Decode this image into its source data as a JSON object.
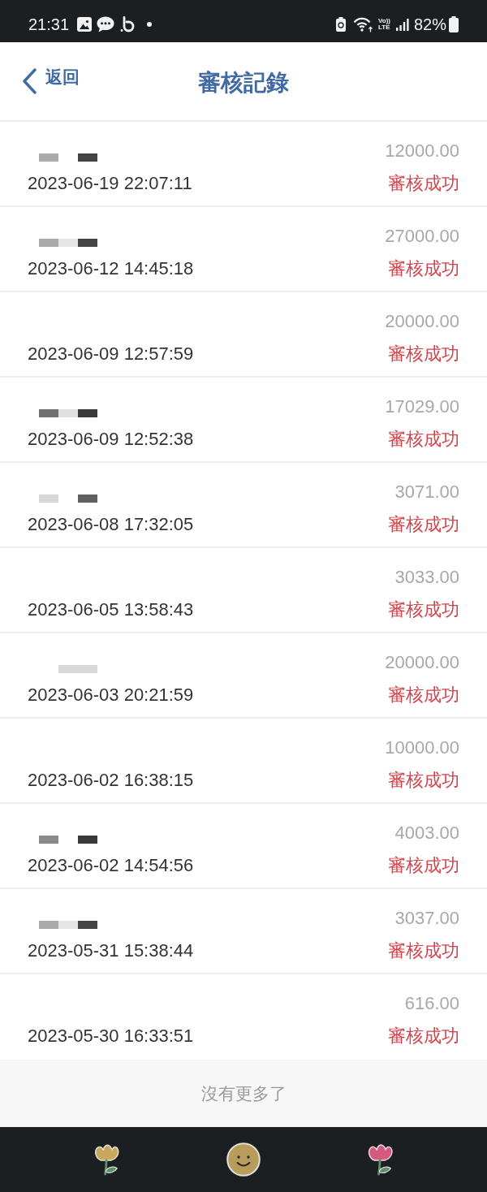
{
  "status_bar": {
    "time": "21:31",
    "volte": {
      "top": "Vo))",
      "bottom": "LTE"
    },
    "battery_text": "82%"
  },
  "header": {
    "back_label": "返回",
    "title": "審核記錄"
  },
  "records": [
    {
      "redaction": [
        {
          "kind": "block",
          "color": "#aaaaaa"
        },
        {
          "kind": "gap"
        },
        {
          "kind": "block",
          "color": "#444444"
        }
      ],
      "time": "2023-06-19 22:07:11",
      "amount": "12000.00",
      "status": "審核成功"
    },
    {
      "redaction": [
        {
          "kind": "block",
          "color": "#aaaaaa"
        },
        {
          "kind": "block",
          "color": "#e6e6e6"
        },
        {
          "kind": "block",
          "color": "#444444"
        }
      ],
      "time": "2023-06-12 14:45:18",
      "amount": "27000.00",
      "status": "審核成功"
    },
    {
      "time": "2023-06-09 12:57:59",
      "amount": "20000.00",
      "status": "審核成功"
    },
    {
      "redaction": [
        {
          "kind": "block",
          "color": "#707070"
        },
        {
          "kind": "block",
          "color": "#e0e0e0"
        },
        {
          "kind": "block",
          "color": "#3a3a3a"
        }
      ],
      "time": "2023-06-09 12:52:38",
      "amount": "17029.00",
      "status": "審核成功"
    },
    {
      "redaction": [
        {
          "kind": "block",
          "color": "#d8d8d8"
        },
        {
          "kind": "gap"
        },
        {
          "kind": "block",
          "color": "#606060"
        }
      ],
      "time": "2023-06-08 17:32:05",
      "amount": "3071.00",
      "status": "審核成功"
    },
    {
      "time": "2023-06-05 13:58:43",
      "amount": "3033.00",
      "status": "審核成功"
    },
    {
      "redaction": [
        {
          "kind": "gap"
        },
        {
          "kind": "block",
          "color": "#d8d8d8"
        },
        {
          "kind": "block",
          "color": "#d8d8d8"
        }
      ],
      "time": "2023-06-03 20:21:59",
      "amount": "20000.00",
      "status": "審核成功"
    },
    {
      "time": "2023-06-02 16:38:15",
      "amount": "10000.00",
      "status": "審核成功"
    },
    {
      "redaction": [
        {
          "kind": "block",
          "color": "#8a8a8a"
        },
        {
          "kind": "gap"
        },
        {
          "kind": "block",
          "color": "#3a3a3a"
        }
      ],
      "time": "2023-06-02 14:54:56",
      "amount": "4003.00",
      "status": "審核成功"
    },
    {
      "redaction": [
        {
          "kind": "block",
          "color": "#aaaaaa"
        },
        {
          "kind": "block",
          "color": "#e6e6e6"
        },
        {
          "kind": "block",
          "color": "#444444"
        }
      ],
      "time": "2023-05-31 15:38:44",
      "amount": "3037.00",
      "status": "審核成功"
    },
    {
      "time": "2023-05-30 16:33:51",
      "amount": "616.00",
      "status": "審核成功"
    }
  ],
  "footer": {
    "text": "沒有更多了"
  }
}
